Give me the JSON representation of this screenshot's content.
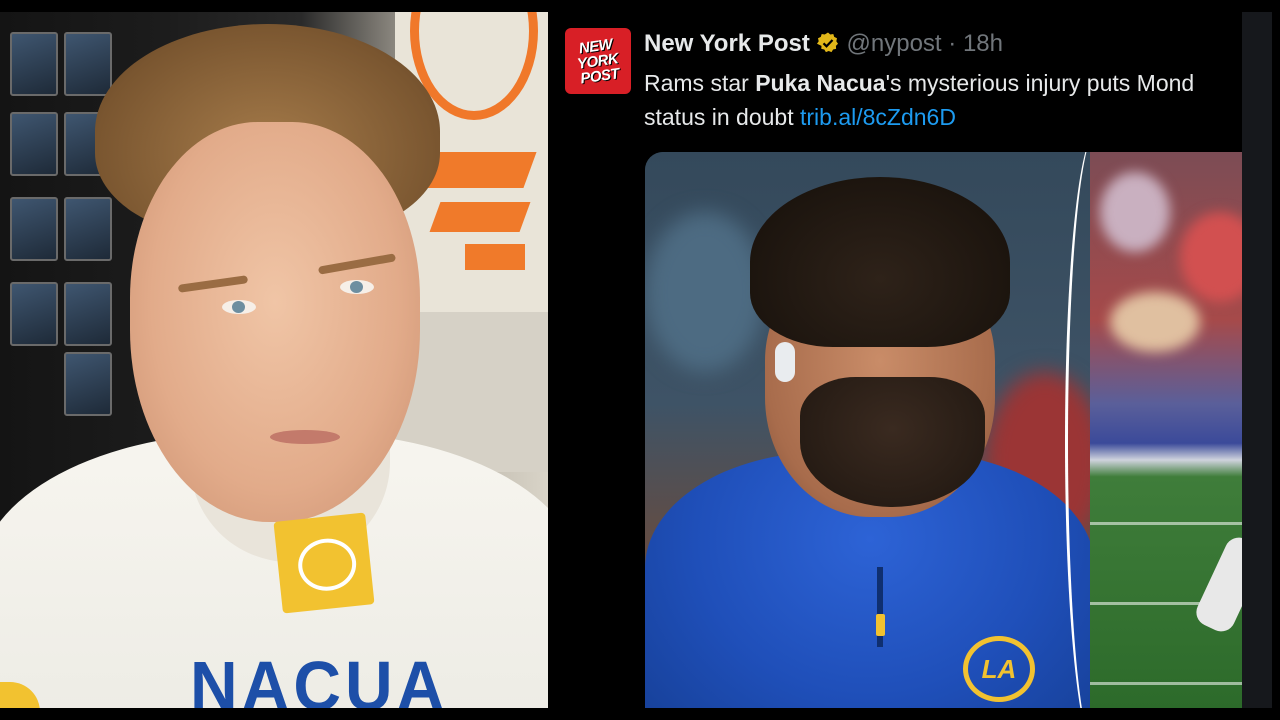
{
  "jersey": {
    "name_text": "NACUA"
  },
  "tweet": {
    "avatar_logo_lines": [
      "NEW",
      "YORK",
      "POST"
    ],
    "display_name": "New York Post",
    "handle": "@nypost",
    "separator": "·",
    "time": "18h",
    "text_prefix": "Rams star ",
    "text_bold": "Puka Nacua",
    "text_suffix": "'s mysterious injury puts Mond",
    "text_line2": "status in doubt ",
    "link": "trib.al/8cZdn6D",
    "verified_icon": "verified-badge-gold"
  },
  "photo": {
    "hoodie_logo": "LA"
  },
  "colors": {
    "background": "#000000",
    "link": "#1d9bf0",
    "text_primary": "#e7e9ea",
    "text_secondary": "#71767b",
    "nypost_red": "#d81f26",
    "rams_blue": "#1f4fb9",
    "rams_gold": "#f2c230",
    "verified_gold": "#e2b719"
  }
}
